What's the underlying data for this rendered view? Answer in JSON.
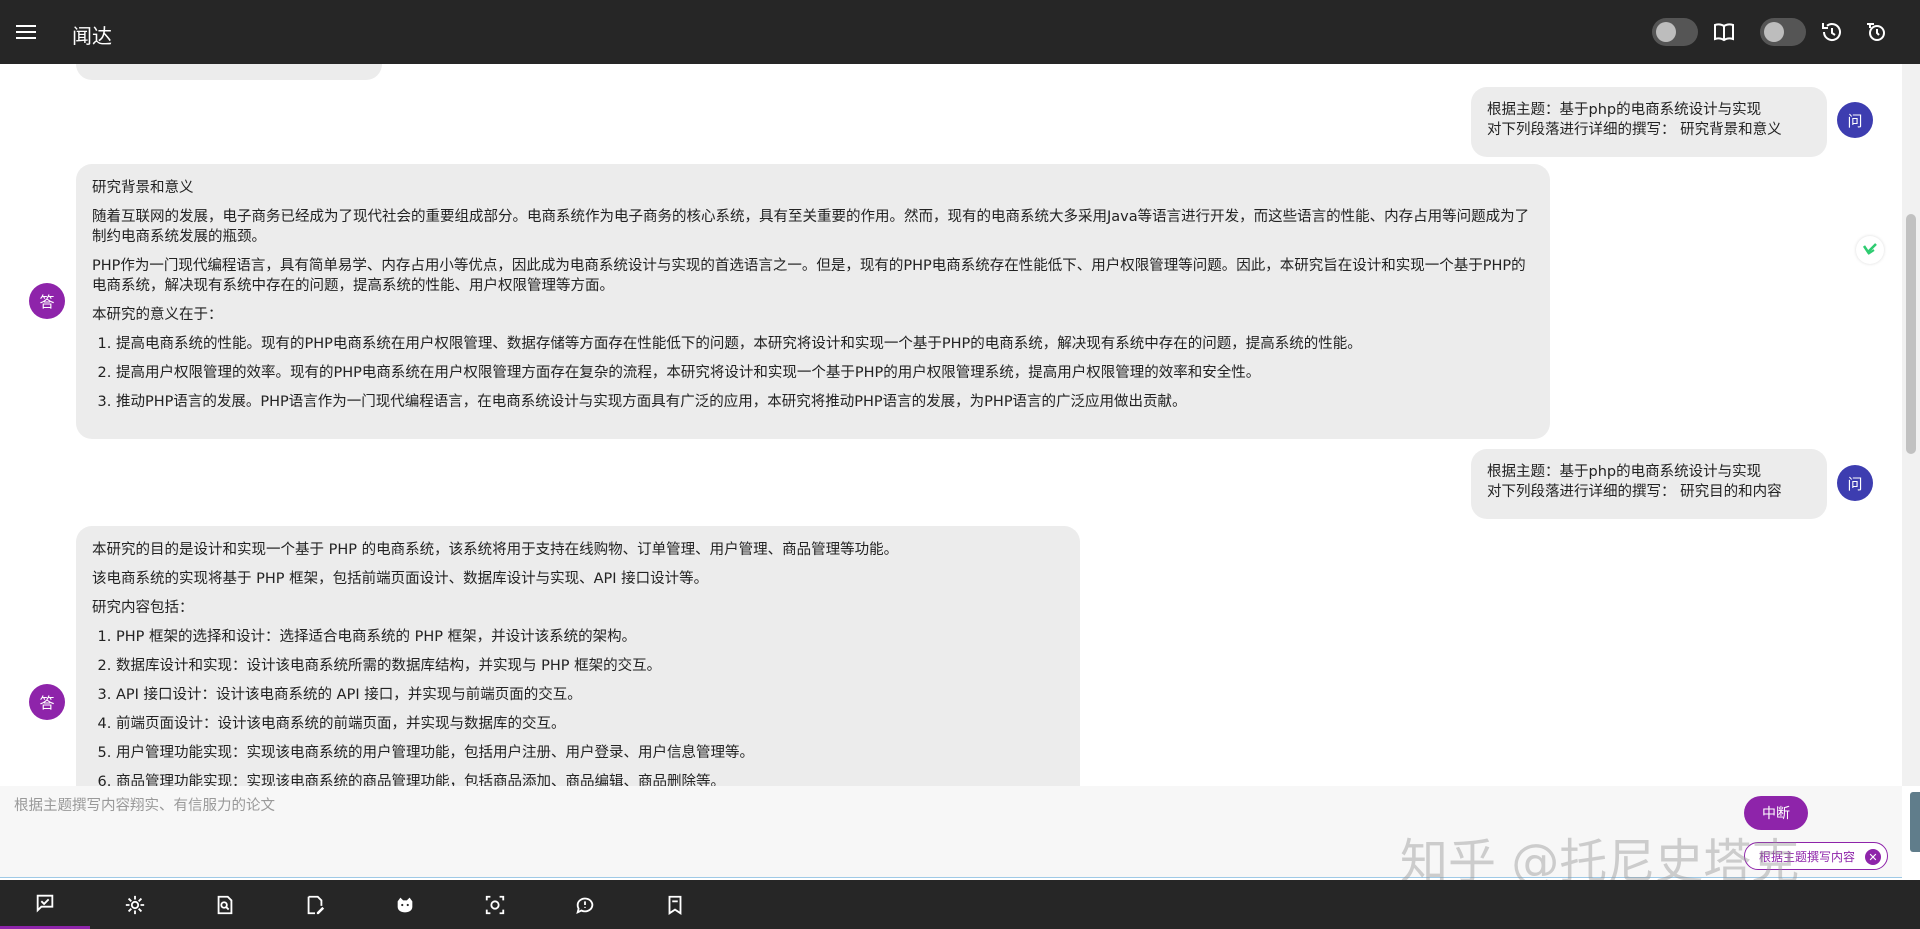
{
  "header": {
    "title": "闻达"
  },
  "messages": {
    "q1": {
      "avatar": "问",
      "line1": "根据主题：基于php的电商系统设计与实现",
      "line2": "对下列段落进行详细的撰写： 研究背景和意义"
    },
    "a1": {
      "avatar": "答",
      "title": "研究背景和意义",
      "p1": "随着互联网的发展，电子商务已经成为了现代社会的重要组成部分。电商系统作为电子商务的核心系统，具有至关重要的作用。然而，现有的电商系统大多采用Java等语言进行开发，而这些语言的性能、内存占用等问题成为了制约电商系统发展的瓶颈。",
      "p2": "PHP作为一门现代编程语言，具有简单易学、内存占用小等优点，因此成为电商系统设计与实现的首选语言之一。但是，现有的PHP电商系统存在性能低下、用户权限管理等问题。因此，本研究旨在设计和实现一个基于PHP的电商系统，解决现有系统中存在的问题，提高系统的性能、用户权限管理等方面。",
      "p3": "本研究的意义在于：",
      "items": [
        "提高电商系统的性能。现有的PHP电商系统在用户权限管理、数据存储等方面存在性能低下的问题，本研究将设计和实现一个基于PHP的电商系统，解决现有系统中存在的问题，提高系统的性能。",
        "提高用户权限管理的效率。现有的PHP电商系统在用户权限管理方面存在复杂的流程，本研究将设计和实现一个基于PHP的用户权限管理系统，提高用户权限管理的效率和安全性。",
        "推动PHP语言的发展。PHP语言作为一门现代编程语言，在电商系统设计与实现方面具有广泛的应用，本研究将推动PHP语言的发展，为PHP语言的广泛应用做出贡献。"
      ]
    },
    "q2": {
      "avatar": "问",
      "line1": "根据主题：基于php的电商系统设计与实现",
      "line2": "对下列段落进行详细的撰写： 研究目的和内容"
    },
    "a2": {
      "avatar": "答",
      "p1": "本研究的目的是设计和实现一个基于 PHP 的电商系统，该系统将用于支持在线购物、订单管理、用户管理、商品管理等功能。",
      "p2": "该电商系统的实现将基于 PHP 框架，包括前端页面设计、数据库设计与实现、API 接口设计等。",
      "p3": "研究内容包括：",
      "items": [
        "PHP 框架的选择和设计：选择适合电商系统的 PHP 框架，并设计该系统的架构。",
        "数据库设计和实现：设计该电商系统所需的数据库结构，并实现与 PHP 框架的交互。",
        "API 接口设计：设计该电商系统的 API 接口，并实现与前端页面的交互。",
        "前端页面设计：设计该电商系统的前端页面，并实现与数据库的交互。",
        "用户管理功能实现：实现该电商系统的用户管理功能，包括用户注册、用户登录、用户信息管理等。",
        "商品管理功能实现：实现该电商系统的商品管理功能，包括商品添加、商品编辑、商品删除等。"
      ]
    }
  },
  "input": {
    "placeholder": "根据主题撰写内容翔实、有信服力的论文",
    "stop_label": "中断",
    "chip_label": "根据主题撰写内容",
    "watermark": "知乎 @托尼史塔克"
  },
  "colors": {
    "header_bg": "#262626",
    "accent_purple": "#8e24aa",
    "question_avatar": "#3d3db0",
    "bubble_bg": "#ececec"
  },
  "bottom_nav": {
    "items": [
      "chat-icon",
      "settings-icon",
      "search-doc-icon",
      "edit-doc-icon",
      "cat-icon",
      "camera-icon",
      "feedback-icon",
      "bookmark-icon"
    ]
  }
}
